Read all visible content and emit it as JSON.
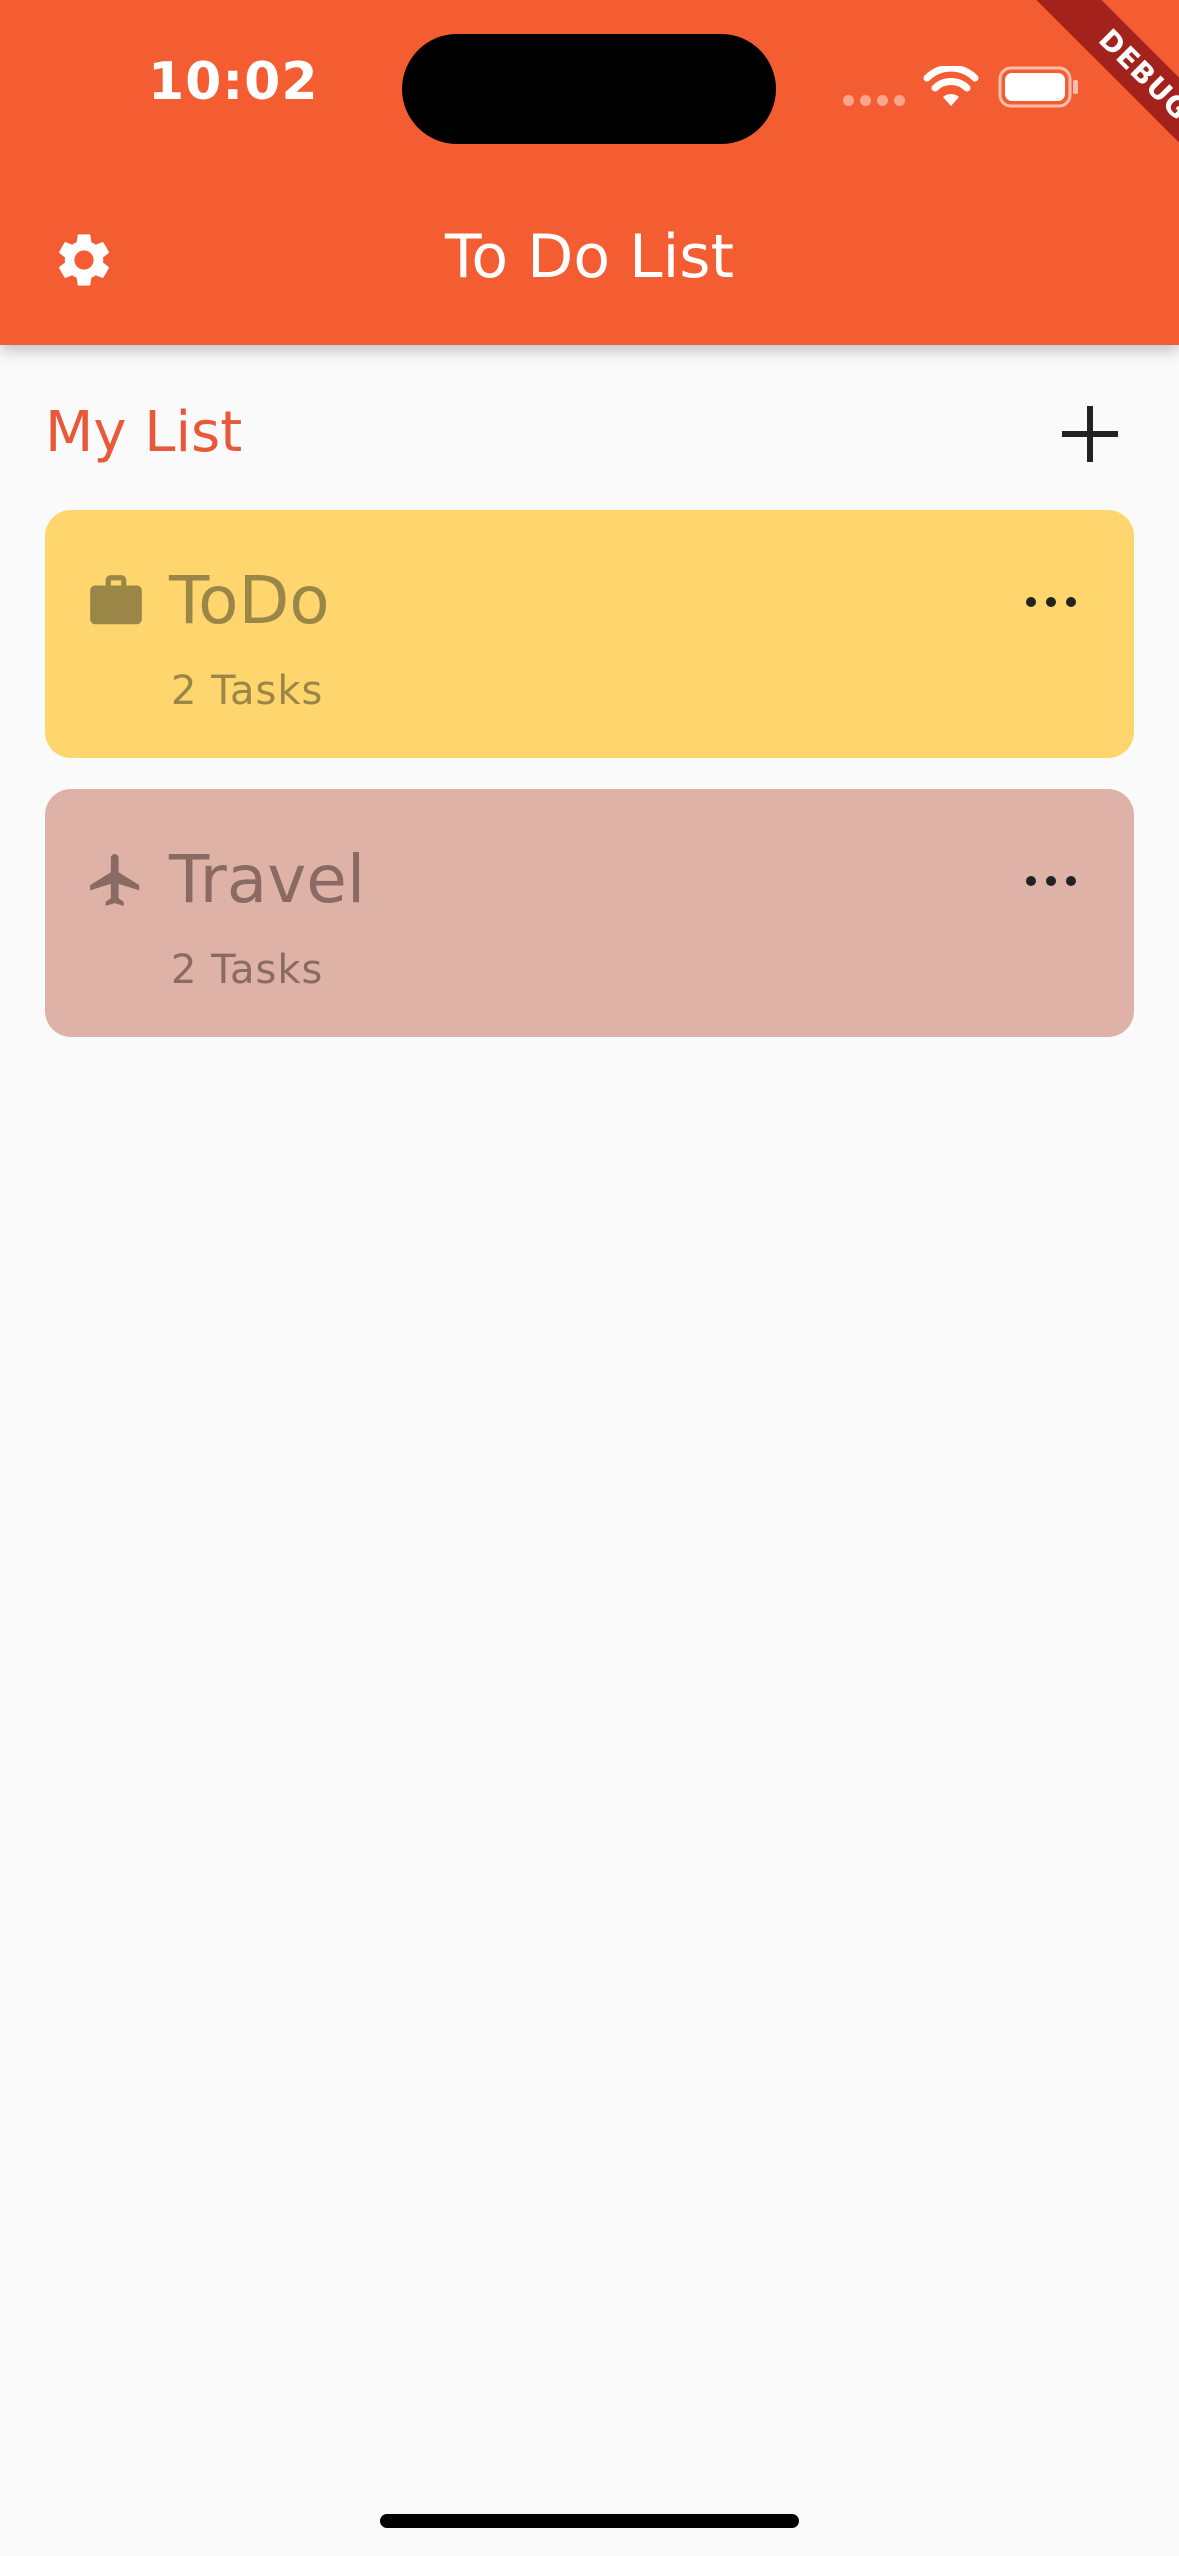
{
  "status_bar": {
    "time": "10:02"
  },
  "debug_banner": {
    "label": "DEBUG"
  },
  "app_bar": {
    "title": "To Do List",
    "settings_icon": "gear-icon"
  },
  "section": {
    "title": "My List",
    "add_icon": "plus-icon"
  },
  "lists": [
    {
      "icon": "briefcase-icon",
      "title": "ToDo",
      "count_label": "2 Tasks",
      "color": "#ffd56e"
    },
    {
      "icon": "airplane-icon",
      "title": "Travel",
      "count_label": "2 Tasks",
      "color": "#dfb2a8"
    }
  ],
  "colors": {
    "app_bar": "#f45d32",
    "section_title": "#e8593a",
    "background": "#fafafa"
  }
}
